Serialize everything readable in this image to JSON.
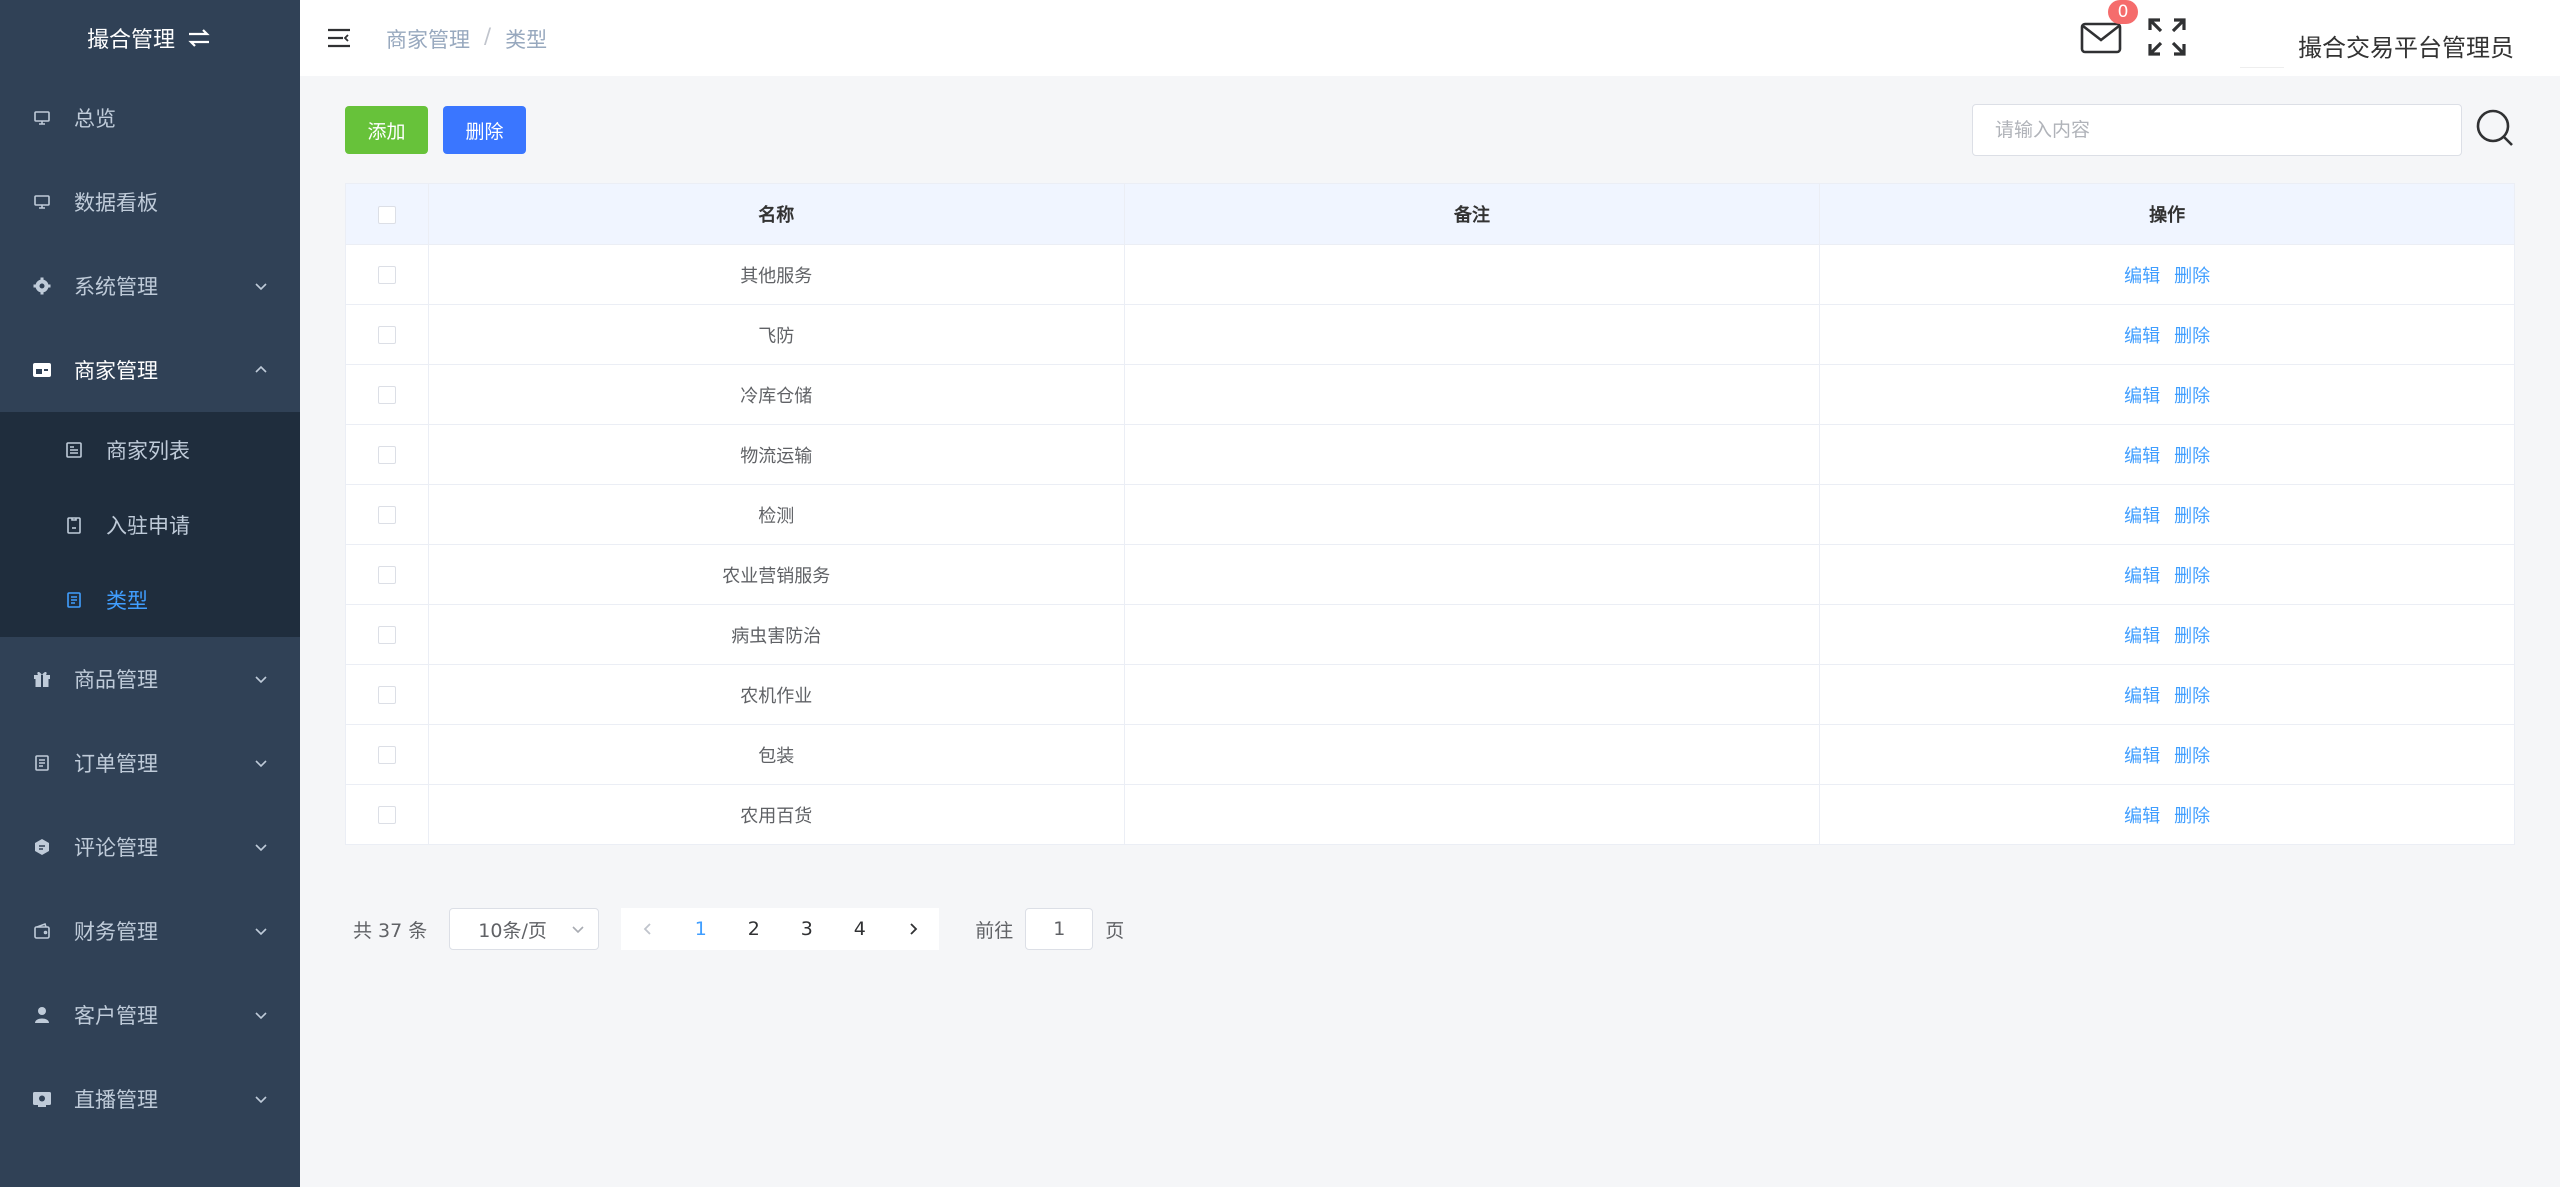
{
  "sidebar": {
    "title": "撮合管理",
    "items": [
      {
        "label": "总览",
        "icon": "monitor-icon"
      },
      {
        "label": "数据看板",
        "icon": "monitor-icon"
      },
      {
        "label": "系统管理",
        "icon": "gear-icon"
      },
      {
        "label": "商家管理",
        "icon": "store-icon"
      },
      {
        "label": "商品管理",
        "icon": "gift-icon"
      },
      {
        "label": "订单管理",
        "icon": "document-icon"
      },
      {
        "label": "评论管理",
        "icon": "comment-icon"
      },
      {
        "label": "财务管理",
        "icon": "wallet-icon"
      },
      {
        "label": "客户管理",
        "icon": "user-icon"
      },
      {
        "label": "直播管理",
        "icon": "live-icon"
      }
    ],
    "submenu": [
      {
        "label": "商家列表",
        "icon": "list-icon"
      },
      {
        "label": "入驻申请",
        "icon": "clipboard-icon"
      },
      {
        "label": "类型",
        "icon": "document-icon"
      }
    ]
  },
  "header": {
    "breadcrumb": [
      "商家管理",
      "类型"
    ],
    "breadcrumb_sep": "/",
    "mail_badge": "0",
    "admin_name": "撮合交易平台管理员"
  },
  "toolbar": {
    "add_label": "添加",
    "delete_label": "删除",
    "search_placeholder": "请输入内容"
  },
  "table": {
    "headers": [
      "名称",
      "备注",
      "操作"
    ],
    "rows": [
      {
        "name": "其他服务",
        "note": ""
      },
      {
        "name": "飞防",
        "note": ""
      },
      {
        "name": "冷库仓储",
        "note": ""
      },
      {
        "name": "物流运输",
        "note": ""
      },
      {
        "name": "检测",
        "note": ""
      },
      {
        "name": "农业营销服务",
        "note": ""
      },
      {
        "name": "病虫害防治",
        "note": ""
      },
      {
        "name": "农机作业",
        "note": ""
      },
      {
        "name": "包装",
        "note": ""
      },
      {
        "name": "农用百货",
        "note": ""
      }
    ],
    "edit_label": "编辑",
    "delete_label": "删除"
  },
  "pagination": {
    "total": "共 37 条",
    "page_size": "10条/页",
    "pages": [
      "1",
      "2",
      "3",
      "4"
    ],
    "current": "1",
    "goto_prefix": "前往",
    "goto_value": "1",
    "goto_suffix": "页"
  },
  "colors": {
    "sidebar_bg": "#304156",
    "submenu_bg": "#1f2d3d",
    "active": "#409eff",
    "add_button": "#67c23a",
    "delete_button": "#3a76ff",
    "badge": "#f56c6c",
    "table_header": "#f0f5ff"
  }
}
